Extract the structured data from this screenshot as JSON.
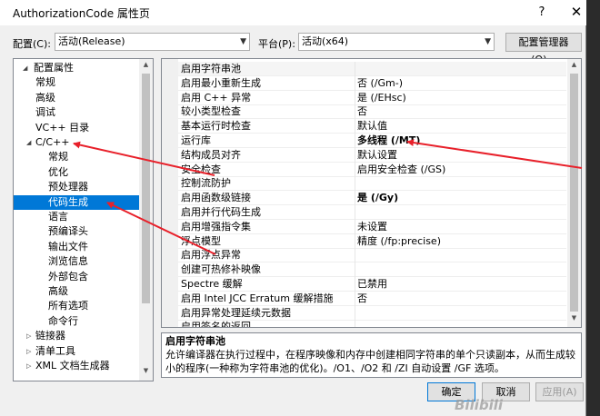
{
  "window": {
    "title": "AuthorizationCode 属性页",
    "help": "?",
    "close": "✕"
  },
  "config": {
    "label": "配置(C):",
    "value": "活动(Release)"
  },
  "platform": {
    "label": "平台(P):",
    "value": "活动(x64)"
  },
  "config_manager": "配置管理器(O)...",
  "tree": [
    {
      "label": "配置属性",
      "indent": 0,
      "expander": "◢"
    },
    {
      "label": "常规",
      "indent": 2
    },
    {
      "label": "高级",
      "indent": 2
    },
    {
      "label": "调试",
      "indent": 2
    },
    {
      "label": "VC++ 目录",
      "indent": 2
    },
    {
      "label": "C/C++",
      "indent": 1,
      "expander": "◢"
    },
    {
      "label": "常规",
      "indent": 3
    },
    {
      "label": "优化",
      "indent": 3
    },
    {
      "label": "预处理器",
      "indent": 3
    },
    {
      "label": "代码生成",
      "indent": 3,
      "selected": true
    },
    {
      "label": "语言",
      "indent": 3
    },
    {
      "label": "预编译头",
      "indent": 3
    },
    {
      "label": "输出文件",
      "indent": 3
    },
    {
      "label": "浏览信息",
      "indent": 3
    },
    {
      "label": "外部包含",
      "indent": 3
    },
    {
      "label": "高级",
      "indent": 3
    },
    {
      "label": "所有选项",
      "indent": 3
    },
    {
      "label": "命令行",
      "indent": 3
    },
    {
      "label": "链接器",
      "indent": 1,
      "expander": "▷"
    },
    {
      "label": "清单工具",
      "indent": 1,
      "expander": "▷"
    },
    {
      "label": "XML 文档生成器",
      "indent": 1,
      "expander": "▷"
    }
  ],
  "properties": [
    {
      "name": "启用字符串池",
      "value": "",
      "highlight": true
    },
    {
      "name": "启用最小重新生成",
      "value": "否 (/Gm-)"
    },
    {
      "name": "启用 C++ 异常",
      "value": "是 (/EHsc)"
    },
    {
      "name": "较小类型检查",
      "value": "否"
    },
    {
      "name": "基本运行时检查",
      "value": "默认值"
    },
    {
      "name": "运行库",
      "value": "多线程 (/MT)",
      "bold": true
    },
    {
      "name": "结构成员对齐",
      "value": "默认设置"
    },
    {
      "name": "安全检查",
      "value": "启用安全检查 (/GS)"
    },
    {
      "name": "控制流防护",
      "value": ""
    },
    {
      "name": "启用函数级链接",
      "value": "是 (/Gy)",
      "bold": true
    },
    {
      "name": "启用并行代码生成",
      "value": ""
    },
    {
      "name": "启用增强指令集",
      "value": "未设置"
    },
    {
      "name": "浮点模型",
      "value": "精度 (/fp:precise)"
    },
    {
      "name": "启用浮点异常",
      "value": ""
    },
    {
      "name": "创建可热修补映像",
      "value": ""
    },
    {
      "name": "Spectre 缓解",
      "value": "已禁用"
    },
    {
      "name": "启用 Intel JCC Erratum 缓解措施",
      "value": "否"
    },
    {
      "name": "启用异常处理延续元数据",
      "value": ""
    },
    {
      "name": "启用签名的返回",
      "value": ""
    }
  ],
  "description": {
    "title": "启用字符串池",
    "text": "允许编译器在执行过程中，在程序映像和内存中创建相同字符串的单个只读副本，从而生成较小的程序(一种称为字符串池的优化)。/O1、/O2 和 /ZI 自动设置 /GF 选项。"
  },
  "buttons": {
    "ok": "确定",
    "cancel": "取消",
    "apply": "应用(A)"
  },
  "watermark": "Bilibili",
  "annotation_color": "#e8202a"
}
